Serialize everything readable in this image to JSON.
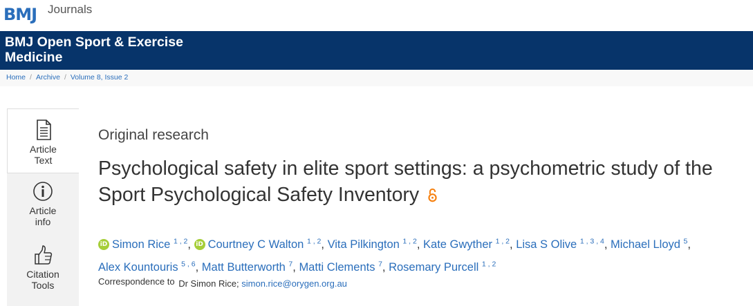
{
  "brand": {
    "bmj": "BMJ",
    "journals": "Journals",
    "brand_color": "#2a6ebb",
    "banner_color": "#07346a"
  },
  "journal": {
    "title": "BMJ Open Sport & Exercise Medicine"
  },
  "breadcrumb": {
    "items": [
      "Home",
      "Archive",
      "Volume 8, Issue 2"
    ],
    "separator": "/"
  },
  "sidebar": {
    "tabs": [
      {
        "label_line1": "Article",
        "label_line2": "Text",
        "icon": "document-icon",
        "active": true
      },
      {
        "label_line1": "Article",
        "label_line2": "info",
        "icon": "info-icon",
        "active": false
      },
      {
        "label_line1": "Citation",
        "label_line2": "Tools",
        "icon": "thumbs-up-icon",
        "active": false
      }
    ]
  },
  "article": {
    "type": "Original research",
    "title": "Psychological safety in elite sport settings: a psychometric study of the Sport Psychological Safety Inventory",
    "open_access_icon": "open-access-icon",
    "open_access_color": "#f68212"
  },
  "authors": [
    {
      "name": "Simon Rice",
      "sup": "1 , 2",
      "orcid": true
    },
    {
      "name": "Courtney C Walton",
      "sup": "1 , 2",
      "orcid": true
    },
    {
      "name": "Vita Pilkington",
      "sup": "1 , 2",
      "orcid": false
    },
    {
      "name": "Kate Gwyther",
      "sup": "1 , 2",
      "orcid": false
    },
    {
      "name": "Lisa S Olive",
      "sup": "1 , 3 , 4",
      "orcid": false
    },
    {
      "name": "Michael Lloyd",
      "sup": "5",
      "orcid": false
    },
    {
      "name": "Alex Kountouris",
      "sup": "5 , 6",
      "orcid": false
    },
    {
      "name": "Matt Butterworth",
      "sup": "7",
      "orcid": false
    },
    {
      "name": "Matti Clements",
      "sup": "7",
      "orcid": false
    },
    {
      "name": "Rosemary Purcell",
      "sup": "1 , 2",
      "orcid": false
    }
  ],
  "orcid_badge": "iD",
  "correspondence": {
    "label": "Correspondence to",
    "name": "Dr Simon Rice;",
    "email": "simon.rice@orygen.org.au"
  }
}
